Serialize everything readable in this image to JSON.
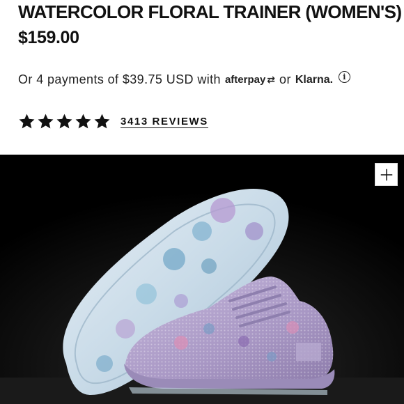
{
  "product": {
    "title": "WATERCOLOR FLORAL TRAINER (WOMEN'S)",
    "price": "$159.00"
  },
  "payments": {
    "prefix": "Or 4 payments of $39.75 USD with",
    "afterpay_label": "afterpay",
    "separator": "or",
    "klarna_label": "Klarna.",
    "info_icon": "i"
  },
  "rating": {
    "stars": 5,
    "star_color": "#111111",
    "reviews_link": "3413 REVIEWS"
  },
  "hero": {
    "background_color": "#000000",
    "shoe_color": "#a897c4",
    "sole_color": "#d9e8f2",
    "zoom_icon": "plus-icon"
  }
}
